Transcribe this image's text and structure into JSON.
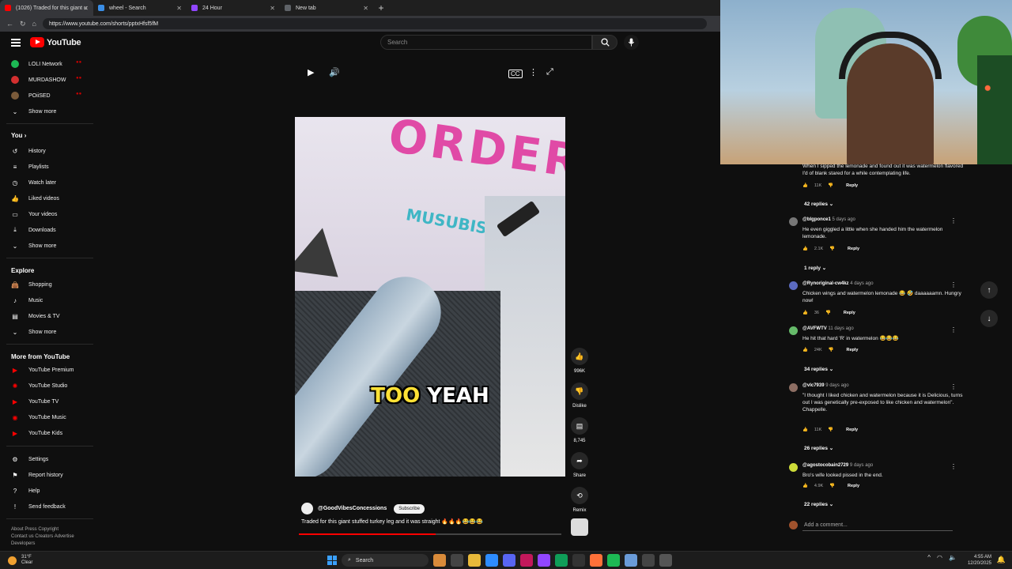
{
  "browser": {
    "tabs": [
      {
        "label": "(1026) Traded for this giant u",
        "color": "#ff0000"
      },
      {
        "label": "wheel - Search",
        "color": "#3a8ee6"
      },
      {
        "label": "24 Hour",
        "color": "#9146ff"
      },
      {
        "label": "New tab",
        "color": "#5f6368"
      }
    ],
    "url": "https://www.youtube.com/shorts/pptxHfsf5fM"
  },
  "header": {
    "logo_text": "YouTube",
    "search_placeholder": "Search"
  },
  "sidebar": {
    "subscriptions": [
      {
        "label": "LOLI Network",
        "color": "#1db954"
      },
      {
        "label": "MURDASHOW",
        "color": "#d32f2f"
      },
      {
        "label": "POiiSED",
        "color": "#7a5a3a"
      }
    ],
    "show_more": "Show more",
    "you_heading": "You",
    "you_items": [
      "History",
      "Playlists",
      "Watch later",
      "Liked videos",
      "Your videos",
      "Downloads",
      "Show more"
    ],
    "explore_heading": "Explore",
    "explore_items": [
      "Shopping",
      "Music",
      "Movies & TV",
      "Show more"
    ],
    "more_heading": "More from YouTube",
    "more_items": [
      "YouTube Premium",
      "YouTube Studio",
      "YouTube TV",
      "YouTube Music",
      "YouTube Kids"
    ],
    "settings_items": [
      "Settings",
      "Report history",
      "Help",
      "Send feedback"
    ],
    "footer_1": "About  Press  Copyright",
    "footer_2": "Contact us  Creators  Advertise",
    "footer_3": "Developers"
  },
  "video": {
    "caption_hl": "TOO",
    "caption_rest": "YEAH",
    "channel": "@GoodVibesConcessions",
    "subscribe": "Subscribe",
    "title": "Traded for this giant stuffed turkey leg and it was straight 🔥🔥🔥😂😂😂",
    "progress": 0.52,
    "likes": "996K",
    "dislike": "Dislike",
    "comments_count": "8,745",
    "share": "Share",
    "remix": "Remix"
  },
  "comments": [
    {
      "text": "When I sipped the lemonade and found out it was watermelon flavored I'd of blank stared for a while contemplating life.",
      "likes": "11K",
      "replies": "42 replies"
    },
    {
      "author": "@blgponce1",
      "ago": "5 days ago",
      "text": "He even giggled a little when she handed him the watermelon lemonade.",
      "likes": "2.1K",
      "replies": "1 reply",
      "color": "#777"
    },
    {
      "author": "@Rynoriginal-cw4kz",
      "ago": "4 days ago",
      "text": "Chicken wings and watermelon lemonade 😂 🤣 daaaaaamn. Hungry now!",
      "likes": "36",
      "color": "#5c6bc0"
    },
    {
      "author": "@AVFWTV",
      "ago": "11 days ago",
      "text": "He hit that hard 'R' in watermelon 😂😂😂",
      "likes": "24K",
      "replies": "34 replies",
      "color": "#66bb6a"
    },
    {
      "author": "@vlc7939",
      "ago": "9 days ago",
      "text": "\"I thought I liked chicken and watermelon because it is Delicious, turns out I was genetically pre-exposed to like chicken and watermelon\". Chappelle.",
      "likes": "11K",
      "replies": "26 replies",
      "color": "#8d6e63"
    },
    {
      "author": "@agostocobain2729",
      "ago": "9 days ago",
      "text": "Bro's wife looked pissed in the end.",
      "likes": "4.9K",
      "replies": "22 replies",
      "color": "#cddc39"
    }
  ],
  "reply_label": "Reply",
  "add_comment": "Add a comment...",
  "taskbar": {
    "temp": "31°F",
    "condition": "Clear",
    "search": "Search",
    "time": "4:55 AM",
    "date": "12/20/2025"
  }
}
